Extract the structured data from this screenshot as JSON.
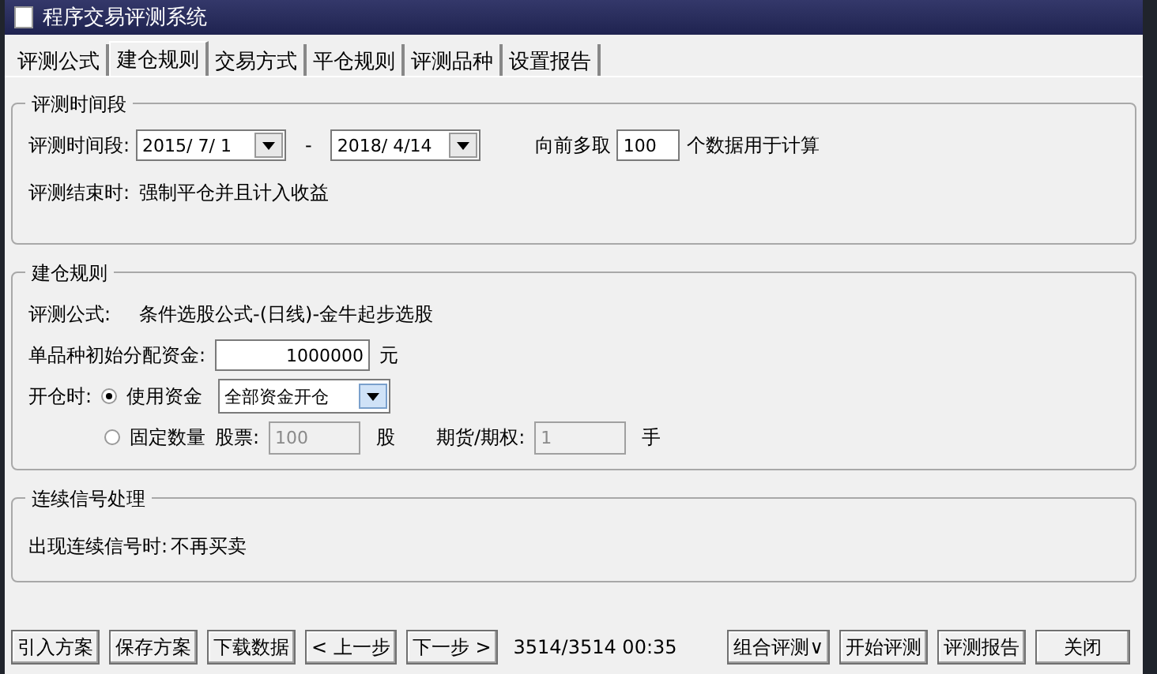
{
  "window": {
    "title": "程序交易评测系统"
  },
  "tabs": [
    {
      "label": "评测公式",
      "selected": false
    },
    {
      "label": "建仓规则",
      "selected": true
    },
    {
      "label": "交易方式",
      "selected": false
    },
    {
      "label": "平仓规则",
      "selected": false
    },
    {
      "label": "评测品种",
      "selected": false
    },
    {
      "label": "设置报告",
      "selected": false
    }
  ],
  "period_group": {
    "title": "评测时间段",
    "label": "评测时间段:",
    "start_date": "2015/ 7/ 1",
    "separator": "-",
    "end_date": "2018/ 4/14",
    "lookback_label": "向前多取",
    "lookback_value": "100",
    "lookback_suffix": "个数据用于计算",
    "end_label": "评测结束时:",
    "end_value": "强制平仓并且计入收益"
  },
  "open_group": {
    "title": "建仓规则",
    "formula_label": "评测公式:",
    "formula_value": "条件选股公式-(日线)-金牛起步选股",
    "capital_label": "单品种初始分配资金:",
    "capital_value": "1000000",
    "capital_unit": "元",
    "open_label": "开仓时:",
    "options": [
      {
        "kind": "dropdown",
        "label": "使用资金",
        "selected": true,
        "value": "全部资金开仓"
      },
      {
        "kind": "quantities",
        "label": "固定数量",
        "selected": false,
        "stock_label": "股票:",
        "stock_value": "100",
        "stock_unit": "股",
        "futures_label": "期货/期权:",
        "futures_value": "1",
        "futures_unit": "手"
      }
    ]
  },
  "signal_group": {
    "title": "连续信号处理",
    "label": "出现连续信号时:",
    "value": "不再买卖"
  },
  "footer": {
    "left_buttons": [
      "引入方案",
      "保存方案",
      "下载数据",
      "< 上一步",
      "下一步 >"
    ],
    "status": "3514/3514 00:35",
    "right_buttons": [
      "组合评测∨",
      "开始评测",
      "评测报告",
      "关闭"
    ]
  }
}
